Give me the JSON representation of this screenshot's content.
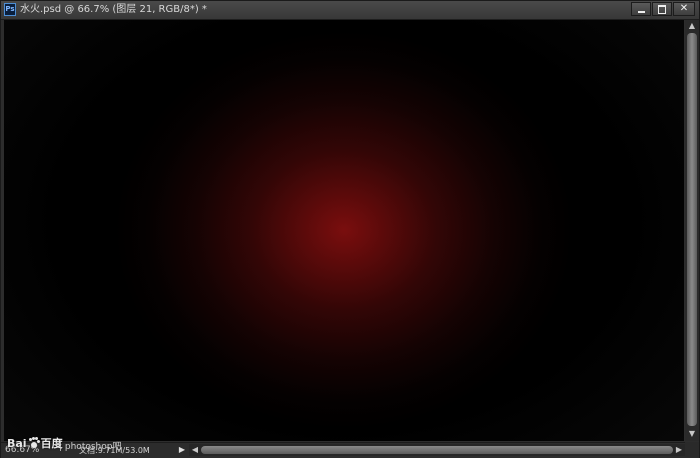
{
  "window": {
    "app_icon_label": "Ps",
    "title": "水火.psd @ 66.7% (图层 21, RGB/8*) *",
    "controls": {
      "minimize_icon": "minimize-icon",
      "maximize_icon": "maximize-icon",
      "close_label": "✕"
    }
  },
  "canvas": {
    "center_color": "#7a0e0e",
    "background_color": "#000000"
  },
  "scrollbar": {
    "up_arrow": "▲",
    "down_arrow": "▼",
    "left_arrow": "◀",
    "right_arrow": "▶"
  },
  "status": {
    "zoom": "66.67%",
    "doc_info": "文档:9.71M/53.0M",
    "menu_arrow": "▶"
  },
  "watermark": {
    "brand_left": "Bai",
    "brand_right": "百度",
    "sub": "| photoshop吧"
  }
}
